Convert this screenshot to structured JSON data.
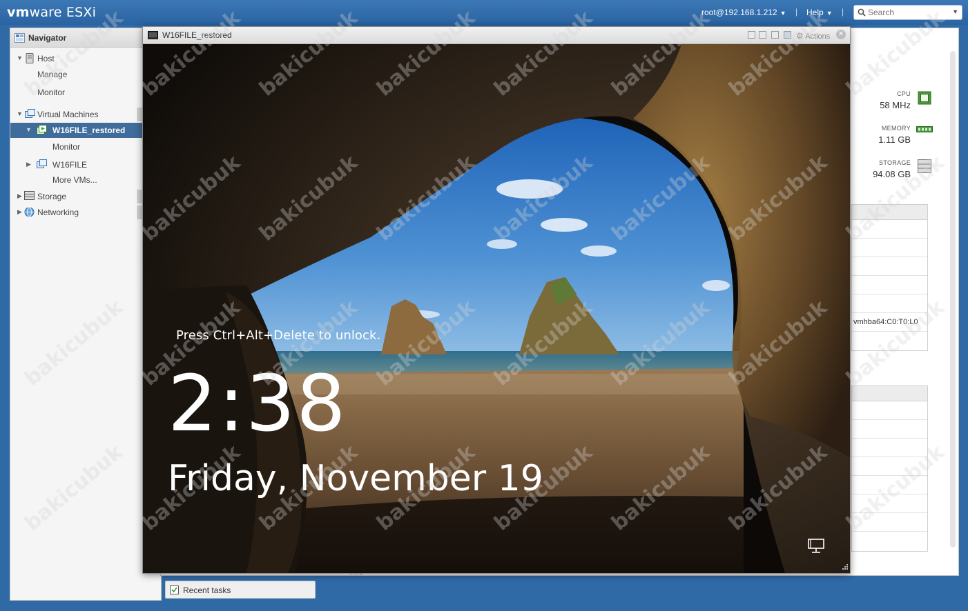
{
  "topbar": {
    "brand_bold": "vm",
    "brand_light": "ware",
    "brand_product": "ESXi",
    "user": "root@192.168.1.212",
    "help": "Help",
    "separator": "|",
    "search_placeholder": "Search"
  },
  "navigator": {
    "title": "Navigator",
    "host": "Host",
    "host_manage": "Manage",
    "host_monitor": "Monitor",
    "virtual_machines": "Virtual Machines",
    "selected_vm": "W16FILE_restored",
    "selected_vm_monitor": "Monitor",
    "other_vm": "W16FILE",
    "more_vms": "More VMs...",
    "storage": "Storage",
    "networking": "Networking"
  },
  "host_summary": {
    "cpu_label": "CPU",
    "cpu_value": "58 MHz",
    "memory_label": "MEMORY",
    "memory_value": "1.11 GB",
    "storage_label": "STORAGE",
    "storage_value": "94.08 GB",
    "adapter_row": "vmhba64:C0:T0:L0",
    "partial_text": "Vmo"
  },
  "recent_tasks": "Recent tasks",
  "console": {
    "title": "W16FILE_restored",
    "actions": "Actions",
    "lock_hint": "Press Ctrl+Alt+Delete to unlock.",
    "time": "2:38",
    "date": "Friday, November 19"
  },
  "watermark": "bakicubuk",
  "colors": {
    "topbar": "#2f6aa6",
    "nav_selected": "#3f6c9b",
    "console_bg": "#0d0b08"
  }
}
